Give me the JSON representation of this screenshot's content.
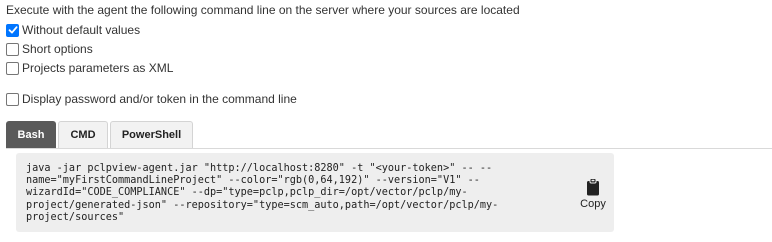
{
  "intro": "Execute with the agent the following command line on the server where your sources are located",
  "options": [
    {
      "label": "Without default values",
      "checked": true
    },
    {
      "label": "Short options",
      "checked": false
    },
    {
      "label": "Projects parameters as XML",
      "checked": false
    }
  ],
  "display_secret": {
    "label": "Display password and/or token in the command line",
    "checked": false
  },
  "tabs": [
    {
      "label": "Bash",
      "active": true
    },
    {
      "label": "CMD",
      "active": false
    },
    {
      "label": "PowerShell",
      "active": false
    }
  ],
  "command_lines": [
    "java -jar pclpview-agent.jar \"http://localhost:8280\" -t \"<your-token>\" -- --",
    "name=\"myFirstCommandLineProject\" --color=\"rgb(0,64,192)\" --version=\"V1\" --",
    "wizardId=\"CODE_COMPLIANCE\" --dp=\"type=pclp,pclp_dir=/opt/vector/pclp/my-",
    "project/generated-json\" --repository=\"type=scm_auto,path=/opt/vector/pclp/my-",
    "project/sources\""
  ],
  "copy_label": "Copy",
  "colors": {
    "checkbox_checked": "#0075ff",
    "active_tab": "#5a5a5a",
    "code_background": "#eeeeee"
  },
  "icons": {
    "check": "check-icon",
    "copy": "clipboard-icon"
  }
}
